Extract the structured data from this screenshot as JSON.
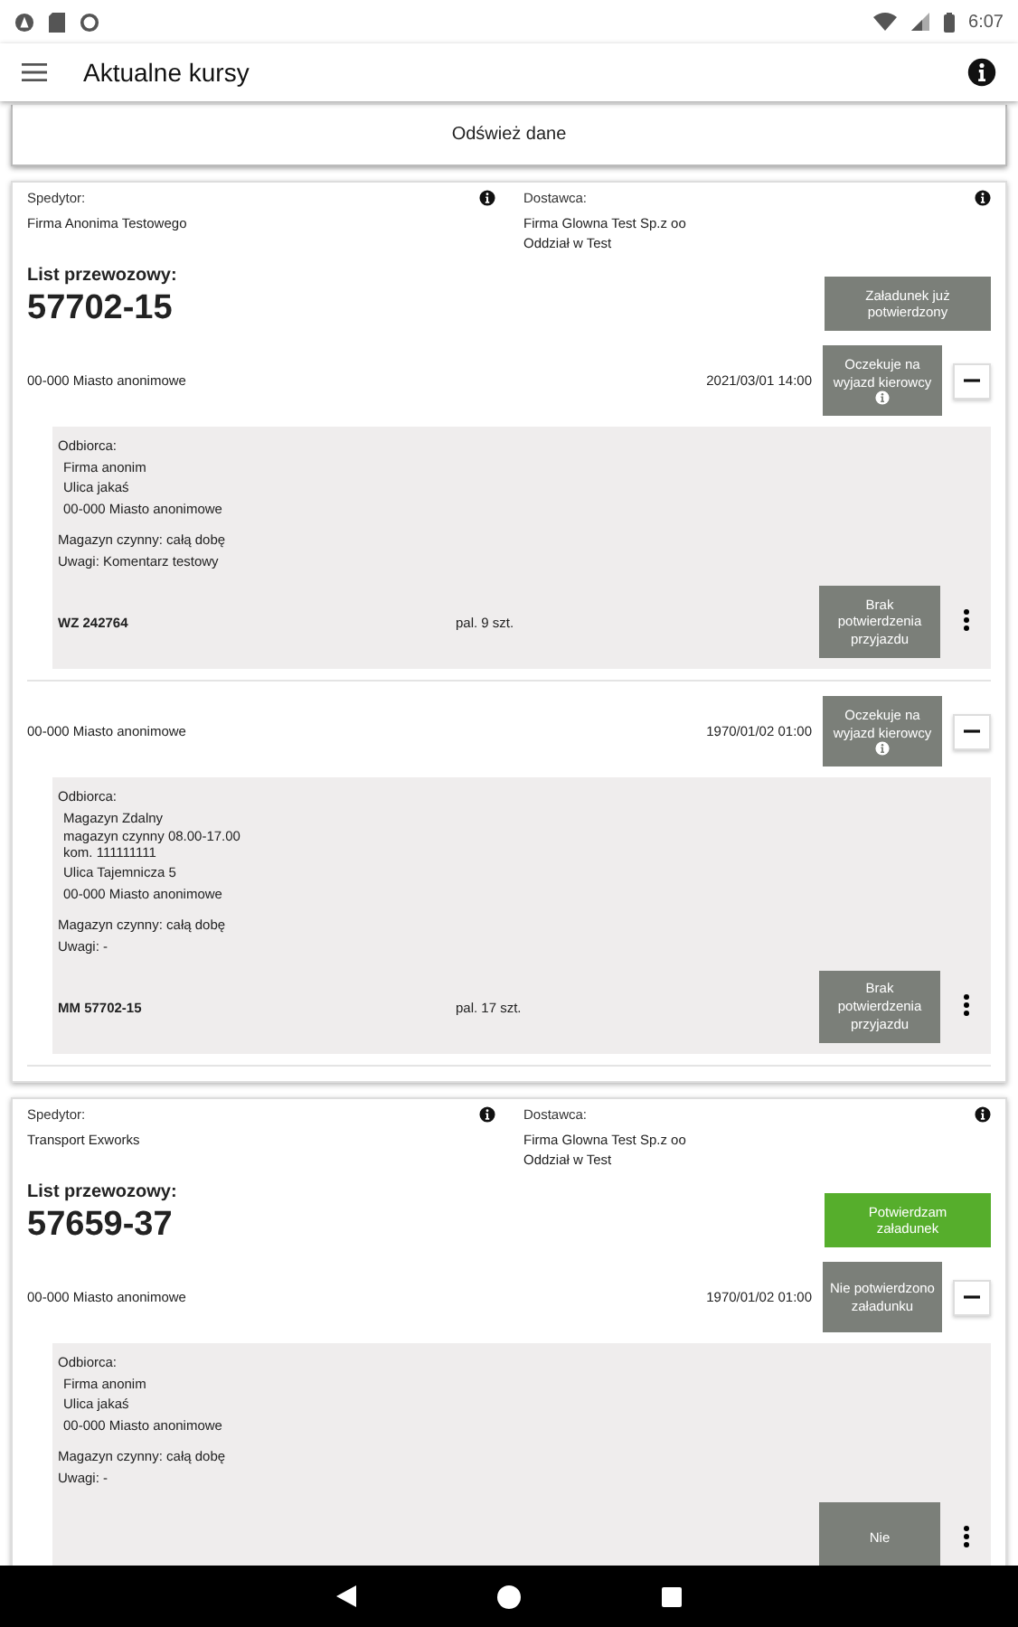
{
  "status_bar": {
    "time": "6:07"
  },
  "app_bar": {
    "title": "Aktualne kursy"
  },
  "refresh_button": "Odśwież dane",
  "shipments": [
    {
      "forwarder_label": "Spedytor:",
      "forwarder": [
        "Firma Anonima Testowego"
      ],
      "supplier_label": "Dostawca:",
      "supplier": [
        "Firma Glowna Test Sp.z oo",
        "Oddział w Test"
      ],
      "waybill_label": "List przewozowy:",
      "waybill": "57702-15",
      "loading_button": {
        "label": "Załadunek już potwierdzony",
        "kind": "confirmed"
      },
      "stops": [
        {
          "city": "00-000 Miasto anonimowe",
          "date": "2021/03/01 14:00",
          "status_button": {
            "label": "Oczekuje na wyjazd kierowcy",
            "info": true
          },
          "expanded": true,
          "recipient_label": "Odbiorca:",
          "recipient_lines": [
            "Firma anonim",
            "Ulica jakaś",
            "00-000 Miasto anonimowe"
          ],
          "hours": "Magazyn czynny: całą dobę",
          "notes": "Uwagi: Komentarz testowy",
          "document": "WZ 242764",
          "quantity": "pal. 9 szt.",
          "delivery_button": "Brak potwierdzenia przyjazdu"
        },
        {
          "city": "00-000 Miasto anonimowe",
          "date": "1970/01/02 01:00",
          "status_button": {
            "label": "Oczekuje na wyjazd kierowcy",
            "info": true
          },
          "expanded": true,
          "recipient_label": "Odbiorca:",
          "recipient_lines": [
            "Magazyn Zdalny\nmagazyn czynny 08.00-17.00\nkom. 111111111",
            "Ulica Tajemnicza 5",
            "00-000 Miasto anonimowe"
          ],
          "hours": "Magazyn czynny: całą dobę",
          "notes": "Uwagi: -",
          "document": "MM 57702-15",
          "quantity": "pal. 17 szt.",
          "delivery_button": "Brak potwierdzenia przyjazdu"
        }
      ]
    },
    {
      "forwarder_label": "Spedytor:",
      "forwarder": [
        "Transport Exworks"
      ],
      "supplier_label": "Dostawca:",
      "supplier": [
        "Firma Glowna Test Sp.z oo",
        "Oddział w Test"
      ],
      "waybill_label": "List przewozowy:",
      "waybill": "57659-37",
      "loading_button": {
        "label": "Potwierdzam załadunek",
        "kind": "action"
      },
      "stops": [
        {
          "city": "00-000 Miasto anonimowe",
          "date": "1970/01/02 01:00",
          "status_button": {
            "label": "Nie potwierdzono załadunku",
            "info": false
          },
          "expanded": true,
          "recipient_label": "Odbiorca:",
          "recipient_lines": [
            "Firma anonim",
            "Ulica jakaś",
            "00-000 Miasto anonimowe"
          ],
          "hours": "Magazyn czynny: całą dobę",
          "notes": "Uwagi: -",
          "delivery_button": "Nie"
        }
      ]
    }
  ]
}
